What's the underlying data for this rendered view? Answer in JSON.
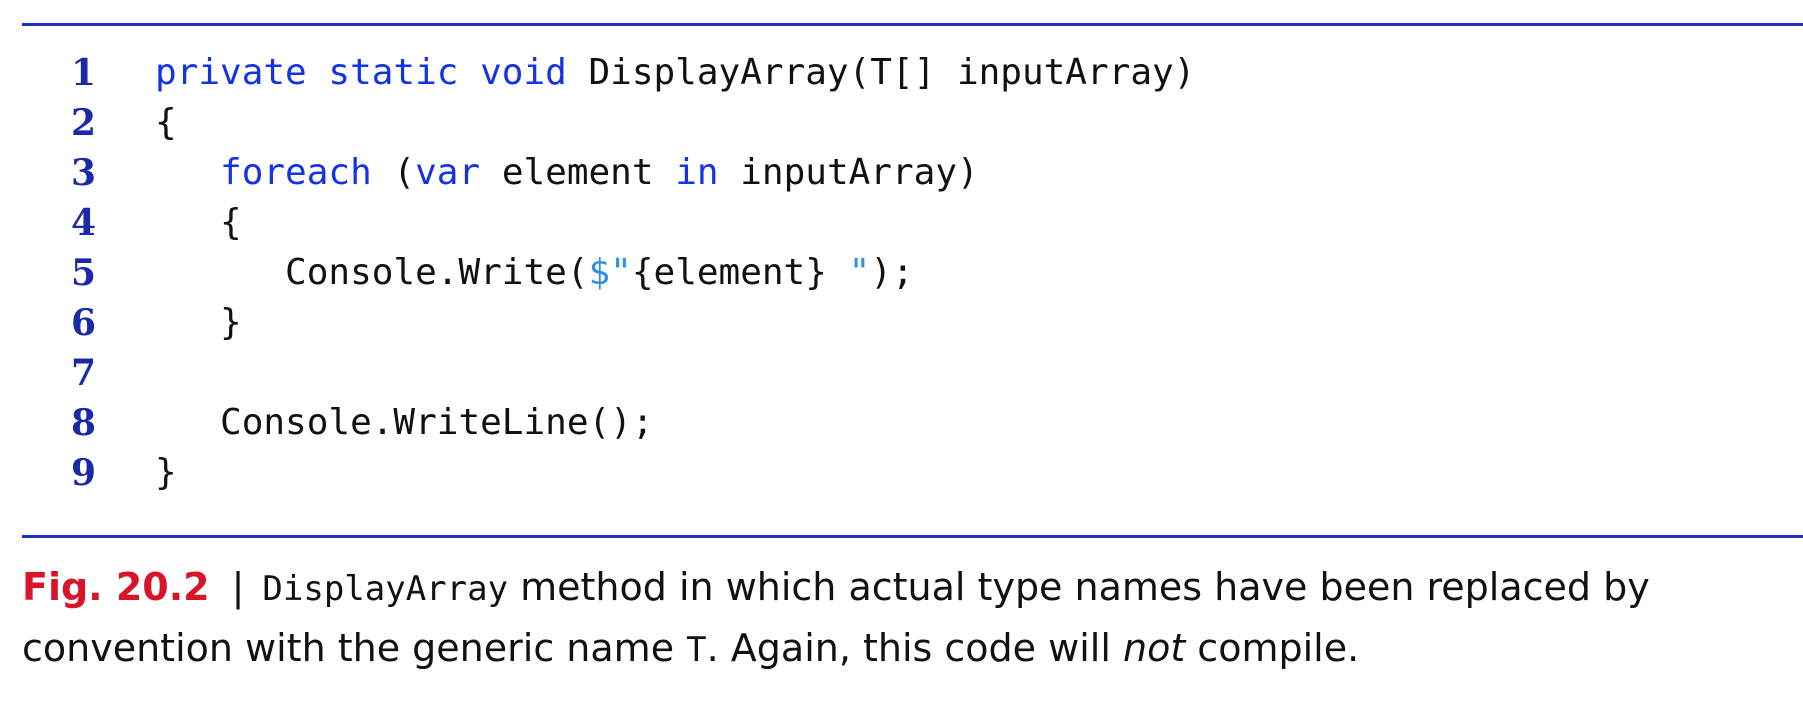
{
  "code": {
    "lines": [
      {
        "num": "1",
        "indent": "",
        "segments": [
          {
            "t": "private static void",
            "c": "kw"
          },
          {
            "t": " DisplayArray(T[] inputArray)",
            "c": "pl"
          }
        ]
      },
      {
        "num": "2",
        "indent": "",
        "segments": [
          {
            "t": "{",
            "c": "pl"
          }
        ]
      },
      {
        "num": "3",
        "indent": "   ",
        "segments": [
          {
            "t": "foreach",
            "c": "kw"
          },
          {
            "t": " (",
            "c": "pl"
          },
          {
            "t": "var",
            "c": "kw"
          },
          {
            "t": " element ",
            "c": "pl"
          },
          {
            "t": "in",
            "c": "kw"
          },
          {
            "t": " inputArray)",
            "c": "pl"
          }
        ]
      },
      {
        "num": "4",
        "indent": "   ",
        "segments": [
          {
            "t": "{",
            "c": "pl"
          }
        ]
      },
      {
        "num": "5",
        "indent": "      ",
        "segments": [
          {
            "t": "Console.Write(",
            "c": "pl"
          },
          {
            "t": "$\"",
            "c": "str"
          },
          {
            "t": "{element}",
            "c": "pl"
          },
          {
            "t": " \"",
            "c": "str"
          },
          {
            "t": ");",
            "c": "pl"
          }
        ]
      },
      {
        "num": "6",
        "indent": "   ",
        "segments": [
          {
            "t": "}",
            "c": "pl"
          }
        ]
      },
      {
        "num": "7",
        "indent": "",
        "segments": []
      },
      {
        "num": "8",
        "indent": "   ",
        "segments": [
          {
            "t": "Console.WriteLine();",
            "c": "pl"
          }
        ]
      },
      {
        "num": "9",
        "indent": "",
        "segments": [
          {
            "t": "}",
            "c": "pl"
          }
        ]
      }
    ]
  },
  "caption": {
    "fig_label": "Fig. 20.2",
    "separator": "|",
    "method_name": "DisplayArray",
    "text_1": " method in which actual type names have been replaced by convention with the generic name ",
    "type_name": "T",
    "text_2": ". Again, this code will ",
    "emphasis": "not",
    "text_3": " compile."
  },
  "colors": {
    "rule": "#1f2fbf",
    "line_numbers": "#1a2aa6",
    "keyword": "#1533e6",
    "string": "#2d8fe6",
    "fig_label": "#d8152b"
  }
}
